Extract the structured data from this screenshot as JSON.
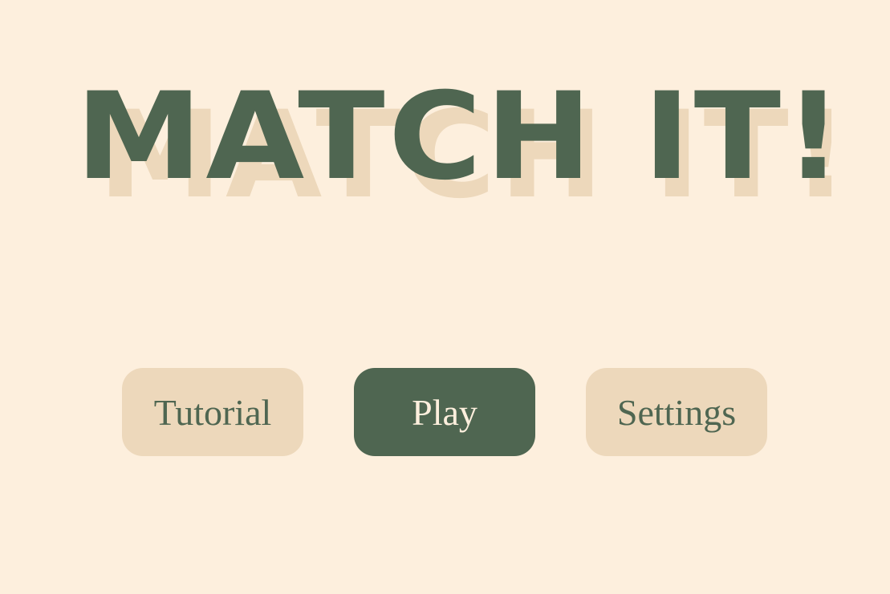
{
  "title": {
    "text": "MATCH IT!"
  },
  "menu": {
    "tutorial_label": "Tutorial",
    "play_label": "Play",
    "settings_label": "Settings"
  },
  "colors": {
    "background": "#fdefdd",
    "primary": "#4f6651",
    "secondary": "#edd8bb"
  }
}
